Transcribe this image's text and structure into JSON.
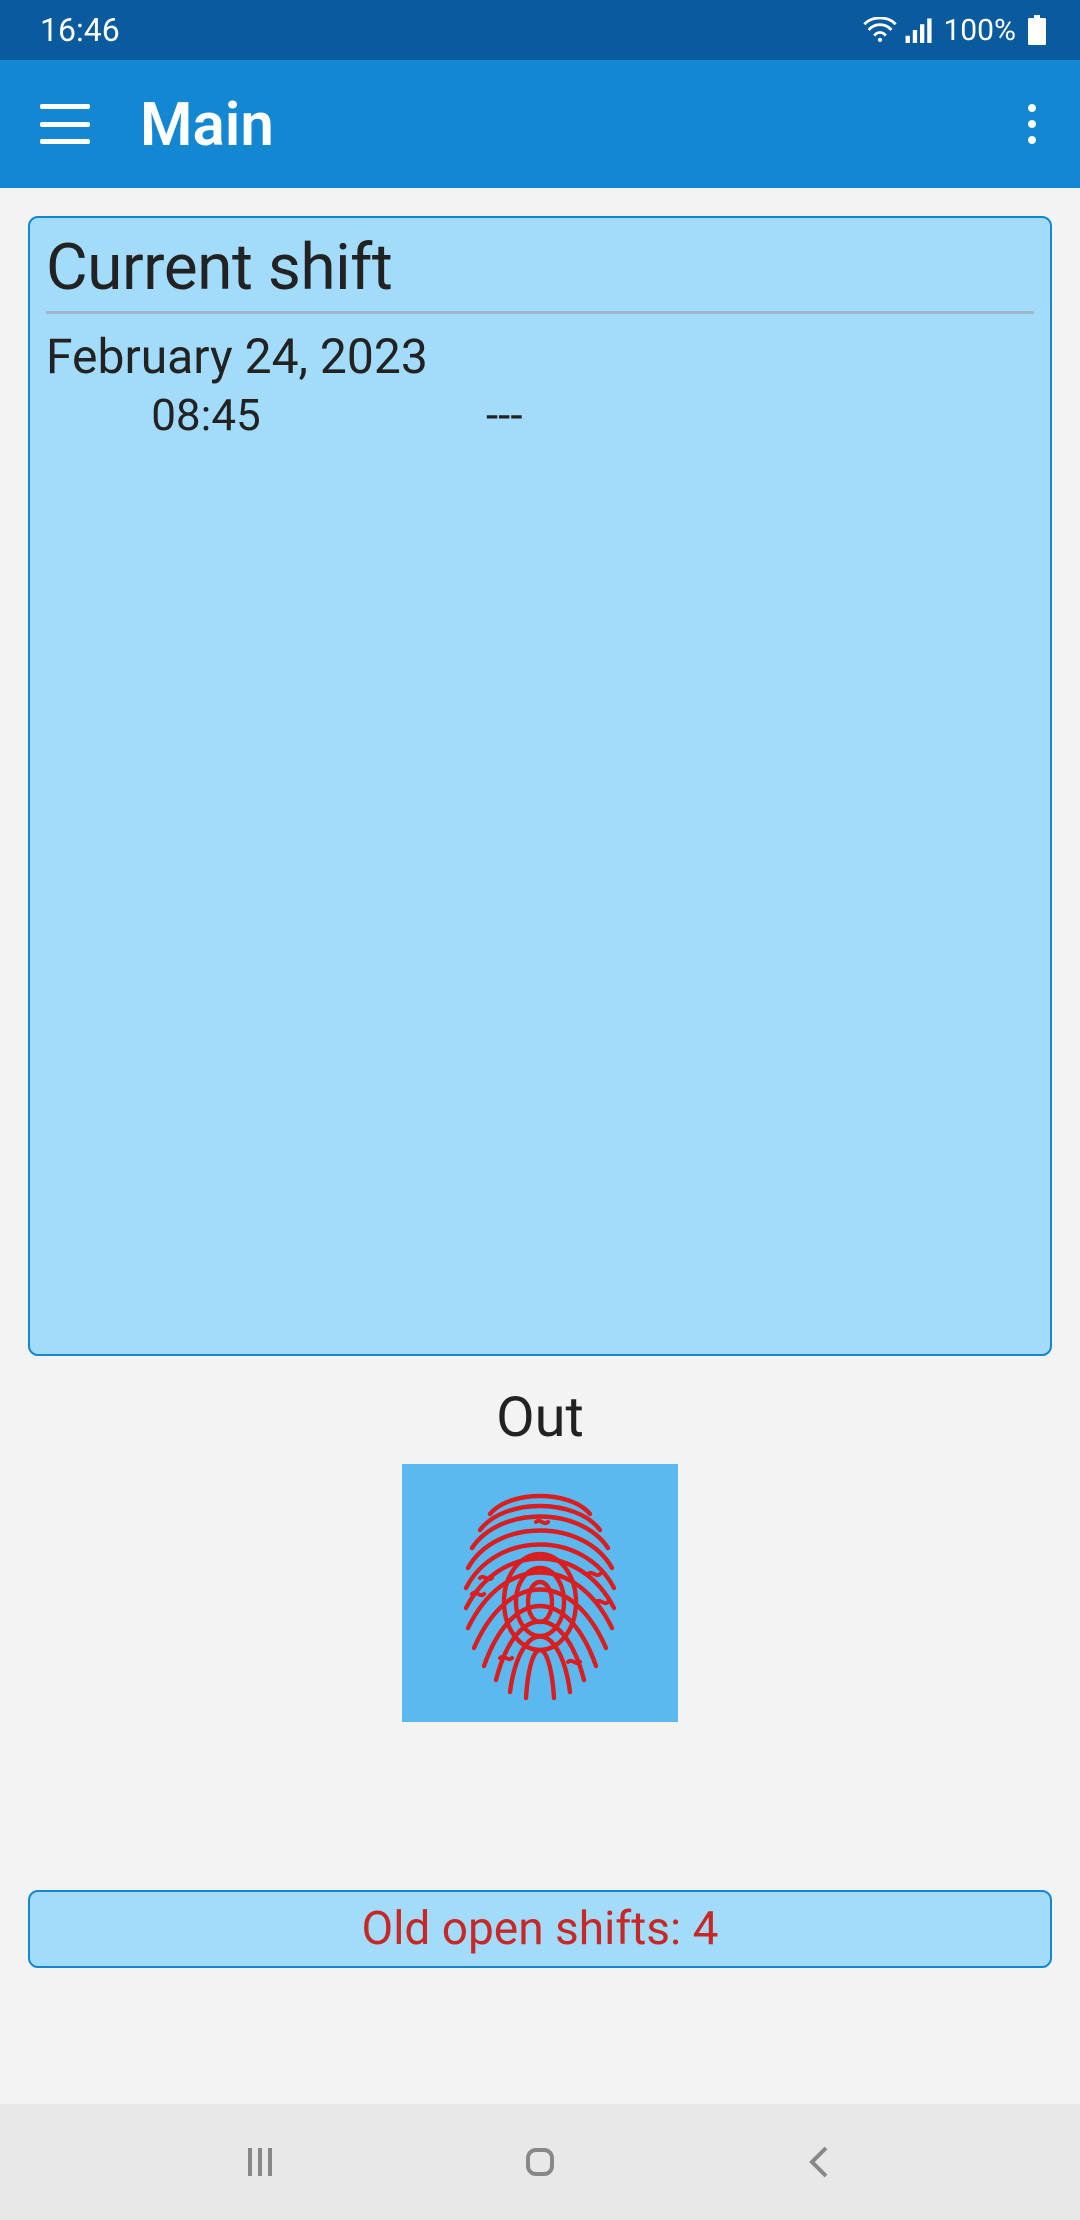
{
  "status": {
    "time": "16:46",
    "battery": "100%"
  },
  "header": {
    "title": "Main"
  },
  "card": {
    "title": "Current shift",
    "date": "February 24, 2023",
    "start_time": "08:45",
    "end_time": "---"
  },
  "action": {
    "label": "Out"
  },
  "footer_button": {
    "label": "Old open shifts: 4"
  }
}
